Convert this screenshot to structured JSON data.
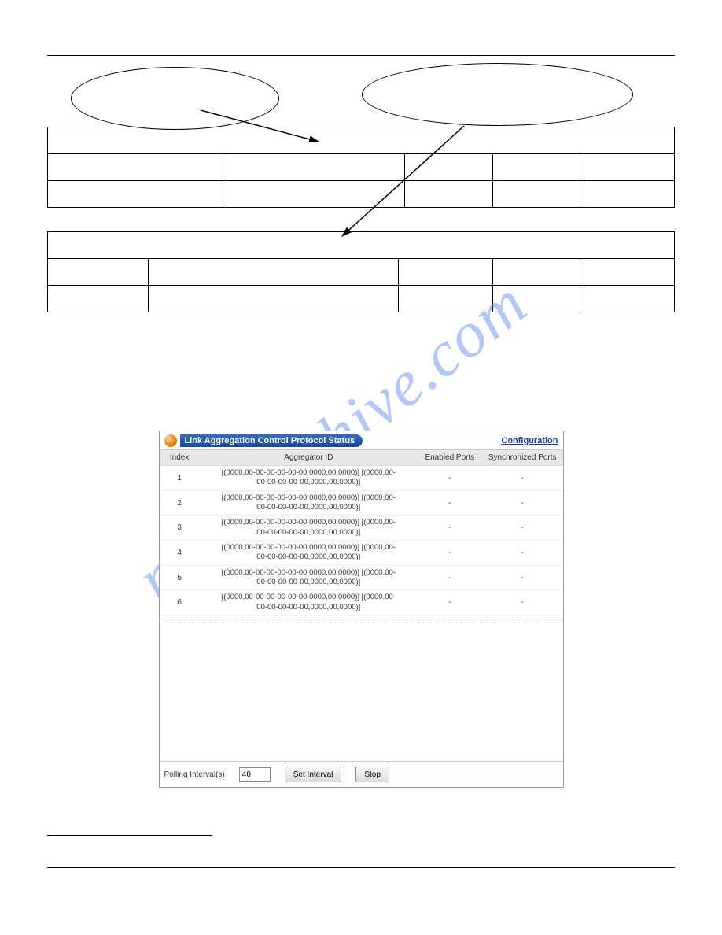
{
  "watermark": "manualshive.com",
  "panel": {
    "title": "Link Aggregation Control Protocol Status",
    "config_link": "Configuration",
    "columns": [
      "Index",
      "Aggregator ID",
      "Enabled Ports",
      "Synchronized Ports"
    ],
    "rows": [
      {
        "index": "1",
        "agg": "[(0000,00-00-00-00-00-00,0000,00,0000)] [(0000,00-\n00-00-00-00-00,0000,00,0000)]",
        "enabled": "-",
        "sync": "-"
      },
      {
        "index": "2",
        "agg": "[(0000,00-00-00-00-00-00,0000,00,0000)] [(0000,00-\n00-00-00-00-00,0000,00,0000)]",
        "enabled": "-",
        "sync": "-"
      },
      {
        "index": "3",
        "agg": "[(0000,00-00-00-00-00-00,0000,00,0000)] [(0000,00-\n00-00-00-00-00,0000,00,0000)]",
        "enabled": "-",
        "sync": "-"
      },
      {
        "index": "4",
        "agg": "[(0000,00-00-00-00-00-00,0000,00,0000)] [(0000,00-\n00-00-00-00-00,0000,00,0000)]",
        "enabled": "-",
        "sync": "-"
      },
      {
        "index": "5",
        "agg": "[(0000,00-00-00-00-00-00,0000,00,0000)] [(0000,00-\n00-00-00-00-00,0000,00,0000)]",
        "enabled": "-",
        "sync": "-"
      },
      {
        "index": "6",
        "agg": "[(0000,00-00-00-00-00-00,0000,00,0000)] [(0000,00-\n00-00-00-00-00,0000,00,0000)]",
        "enabled": "-",
        "sync": "-"
      }
    ]
  },
  "bottombar": {
    "polling_label": "Polling Interval(s)",
    "polling_value": "40",
    "set_interval": "Set Interval",
    "stop": "Stop"
  },
  "tables": {
    "t1": {
      "header_colspan_label": "",
      "cols": [
        "",
        "",
        "",
        "",
        ""
      ]
    },
    "t2": {
      "header_colspan_label": "",
      "cols": [
        "",
        "",
        "",
        "",
        ""
      ]
    }
  }
}
